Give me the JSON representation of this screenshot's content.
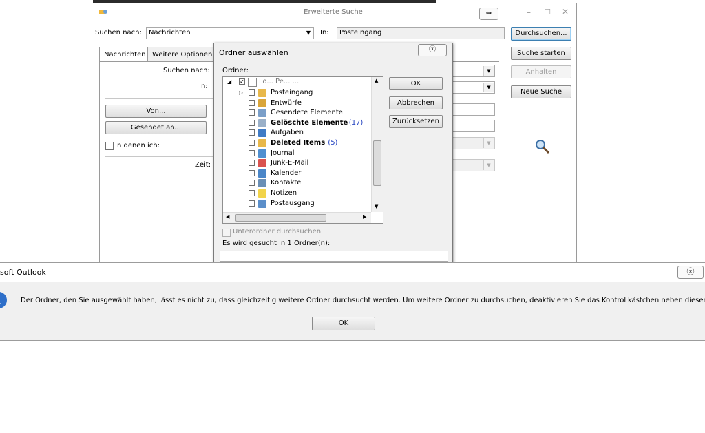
{
  "search_window": {
    "title": "Erweiterte Suche",
    "search_for_label": "Suchen nach:",
    "search_for_value": "Nachrichten",
    "in_label": "In:",
    "in_value": "Posteingang",
    "tabs": [
      "Nachrichten",
      "Weitere Optionen"
    ],
    "inner_search_label": "Suchen nach:",
    "inner_in_label": "In:",
    "from_button": "Von...",
    "sent_to_button": "Gesendet an...",
    "where_i_am_label": "In denen ich:",
    "time_label": "Zeit:",
    "buttons": {
      "search": "Durchsuchen...",
      "start_search": "Suche starten",
      "stop": "Anhalten",
      "new_search": "Neue Suche"
    }
  },
  "folder_dialog": {
    "title": "Ordner auswählen",
    "folders_label": "Ordner:",
    "root_label": "Lo... Pe... ...",
    "folders": [
      {
        "name": "Posteingang",
        "bold": false,
        "count": "",
        "color": "#e8b84a"
      },
      {
        "name": "Entwürfe",
        "bold": false,
        "count": "",
        "color": "#d9a53a"
      },
      {
        "name": "Gesendete Elemente",
        "bold": false,
        "count": "",
        "color": "#7a9fc9"
      },
      {
        "name": "Gelöschte Elemente",
        "bold": true,
        "count": "(17)",
        "color": "#9ab0c8"
      },
      {
        "name": "Aufgaben",
        "bold": false,
        "count": "",
        "color": "#3f7bc5"
      },
      {
        "name": "Deleted Items",
        "bold": true,
        "count": "(5)",
        "color": "#e8b84a"
      },
      {
        "name": "Journal",
        "bold": false,
        "count": "",
        "color": "#4f8fd0"
      },
      {
        "name": "Junk-E-Mail",
        "bold": false,
        "count": "",
        "color": "#d9534f"
      },
      {
        "name": "Kalender",
        "bold": false,
        "count": "",
        "color": "#4a86c8"
      },
      {
        "name": "Kontakte",
        "bold": false,
        "count": "",
        "color": "#6a8fb5"
      },
      {
        "name": "Notizen",
        "bold": false,
        "count": "",
        "color": "#f2d44a"
      },
      {
        "name": "Postausgang",
        "bold": false,
        "count": "",
        "color": "#5b8fca"
      }
    ],
    "buttons": {
      "ok": "OK",
      "cancel": "Abbrechen",
      "reset": "Zurücksetzen"
    },
    "subfolders_label": "Unterordner durchsuchen",
    "status_text": "Es wird gesucht in 1 Ordner(n):",
    "count_color": "#1f3fbf"
  },
  "message_box": {
    "title": "soft Outlook",
    "text": "Der Ordner, den Sie ausgewählt haben, lässt es nicht zu, dass gleichzeitig weitere Ordner durchsucht werden. Um weitere Ordner zu durchsuchen, deaktivieren Sie das Kontrollkästchen neben diesem Ordner.",
    "ok_button": "OK"
  }
}
